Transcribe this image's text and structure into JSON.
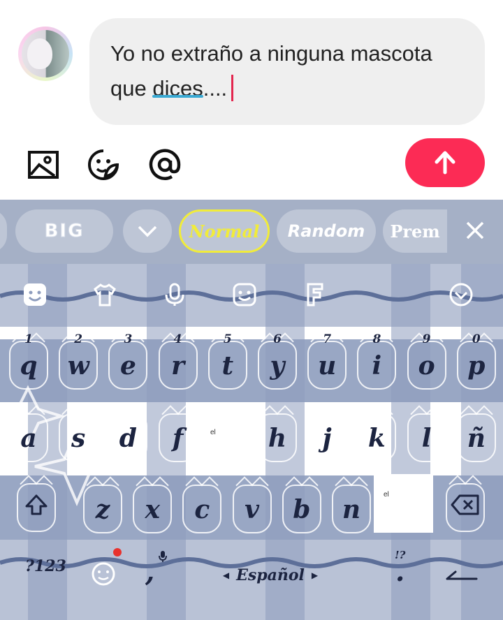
{
  "message": {
    "text_before": "Yo no extraño a ninguna mascota que ",
    "underlined_word": "dices",
    "text_after": "...."
  },
  "composer": {
    "icons": [
      "image-icon",
      "sticker-icon",
      "mention-icon"
    ],
    "send_icon": "arrow-up-icon",
    "accent_color": "#fc2b55"
  },
  "font_styles": {
    "items": [
      "BIG",
      "Normal",
      "Random",
      "Prem"
    ],
    "selected": "Normal"
  },
  "toolbar_icons": [
    "emoji-icon",
    "shirt-icon",
    "microphone-icon",
    "smiley-icon",
    "font-icon",
    "chevron-down-circle-icon"
  ],
  "keys": {
    "row1": [
      {
        "hint": "1",
        "label": "q"
      },
      {
        "hint": "2",
        "label": "w"
      },
      {
        "hint": "3",
        "label": "e"
      },
      {
        "hint": "4",
        "label": "r"
      },
      {
        "hint": "5",
        "label": "t"
      },
      {
        "hint": "6",
        "label": "y"
      },
      {
        "hint": "7",
        "label": "u"
      },
      {
        "hint": "8",
        "label": "i"
      },
      {
        "hint": "9",
        "label": "o"
      },
      {
        "hint": "0",
        "label": "p"
      }
    ],
    "row2": [
      "a",
      "s",
      "d",
      "f",
      "",
      "h",
      "j",
      "k",
      "l",
      "ñ"
    ],
    "row3": [
      "z",
      "x",
      "c",
      "v",
      "b",
      "n"
    ],
    "popup_text": "el",
    "symbols": "?123",
    "comma": ",",
    "space_label": "Español",
    "period": ".",
    "period_hint": "!?"
  }
}
